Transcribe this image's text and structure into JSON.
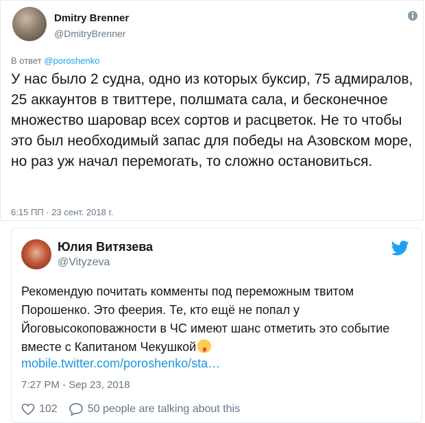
{
  "main_tweet": {
    "author_name": "Dmitry Brenner",
    "author_handle": "@DmitryBrenner",
    "reply_prefix": "В ответ",
    "reply_mention": "@poroshenko",
    "text": "У нас было 2 судна, одно из которых буксир, 75 адмиралов, 25 аккаунтов в твиттере, полшмата сала, и бесконечное множество шаровар всех сортов и расцветок. Не то чтобы это был необходимый запас для победы на Азовском море, но раз уж начал перемогать, то сложно остановиться.",
    "timestamp": "6:15 ПП · 23 сент. 2018 г."
  },
  "quoted_tweet": {
    "author_name": "Юлия Витязева",
    "author_handle": "@Vityzeva",
    "text": "Рекомендую почитать комменты под переможным твитом Порошенко. Это феерия. Те, кто ещё не попал у Йоговысокоповажности в ЧС имеют шанс отметить это событие вместе с Капитаном Чекушкой",
    "link": "mobile.twitter.com/poroshenko/sta…",
    "timestamp": "7:27 PM - Sep 23, 2018",
    "likes": "102",
    "talking": "50 people are talking about this"
  },
  "colors": {
    "link_blue": "#1da1f2",
    "text_dark": "#14171a",
    "text_gray": "#657786"
  },
  "icons": [
    "info-icon",
    "twitter-bird-icon",
    "heart-icon",
    "speech-bubble-icon",
    "emoji-tongue-icon"
  ]
}
